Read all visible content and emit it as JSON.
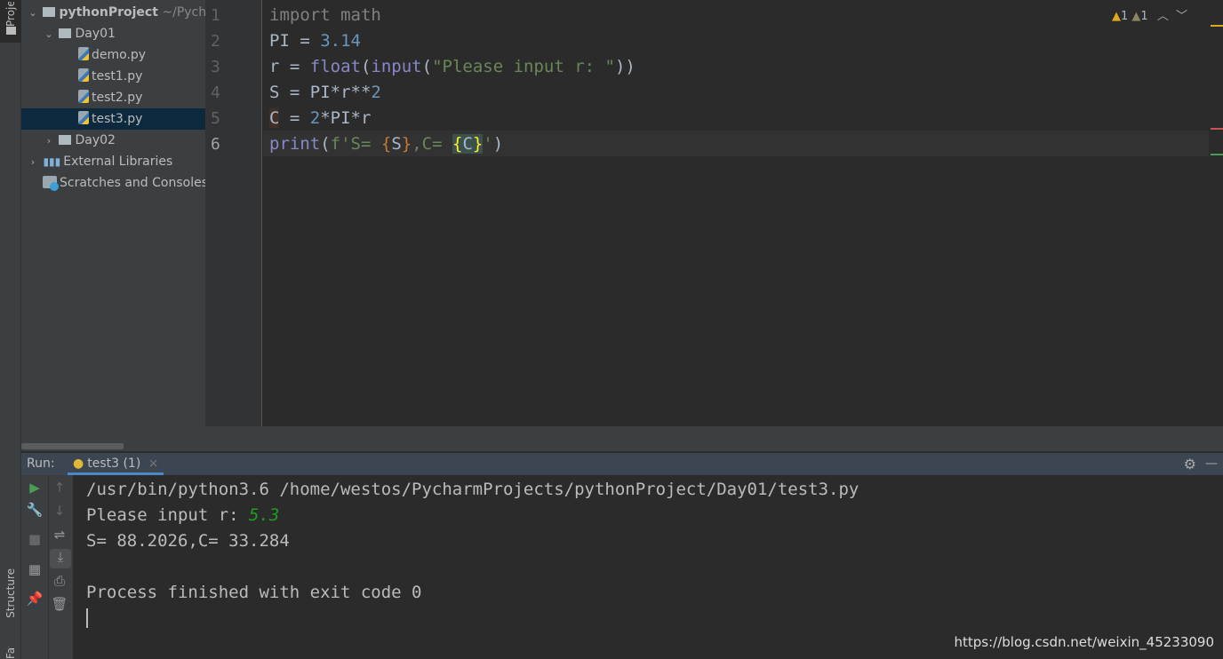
{
  "left_strip": {
    "project_tab": "Project",
    "structure_tab": "Structure",
    "favorites_tab": "Favorites"
  },
  "project_tree": [
    {
      "label": "pythonProject",
      "suffix": "~/PycharmProjects/pythonProject",
      "type": "root",
      "expanded": true
    },
    {
      "label": "Day01",
      "type": "folder",
      "expanded": true
    },
    {
      "label": "demo.py",
      "type": "python-file"
    },
    {
      "label": "test1.py",
      "type": "python-file"
    },
    {
      "label": "test2.py",
      "type": "python-file"
    },
    {
      "label": "test3.py",
      "type": "python-file",
      "selected": true
    },
    {
      "label": "Day02",
      "type": "folder",
      "expanded": false
    },
    {
      "label": "External Libraries",
      "type": "libraries"
    },
    {
      "label": "Scratches and Consoles",
      "type": "scratches"
    }
  ],
  "editor": {
    "line_numbers": [
      "1",
      "2",
      "3",
      "4",
      "5",
      "6"
    ],
    "current_line": 6,
    "lines": [
      "import math",
      "PI = 3.14",
      "r = float(input(\"Please input r: \"))",
      "S = PI*r**2",
      "C = 2*PI*r",
      "print(f'S= {S},C= {C}')"
    ],
    "inspections": {
      "warnings": "1",
      "weak_warnings": "1"
    }
  },
  "run": {
    "label": "Run:",
    "tab": "test3 (1)",
    "output": [
      "/usr/bin/python3.6 /home/westos/PycharmProjects/pythonProject/Day01/test3.py",
      "Please input r: ",
      "S= 88.2026,C= 33.284",
      "",
      "Process finished with exit code 0"
    ],
    "user_input": "5.3"
  },
  "watermark": "https://blog.csdn.net/weixin_45233090",
  "colors": {
    "selection": "#0d293e",
    "keyword": "#808080",
    "number": "#6897bb",
    "builtin": "#8888c6",
    "string": "#6a8759",
    "user_input": "#1f9e1f",
    "run_accent": "#4a88c7"
  }
}
